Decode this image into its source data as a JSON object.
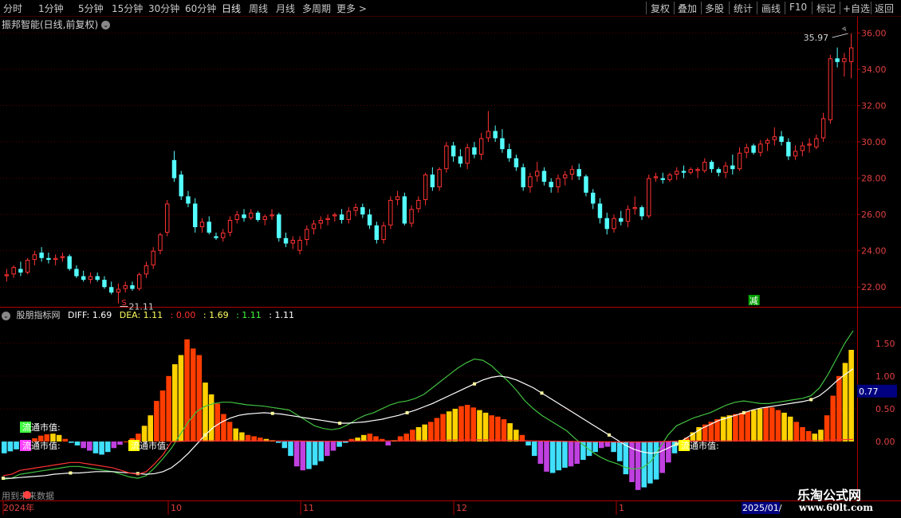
{
  "toolbar": {
    "periods": [
      "分时",
      "1分钟",
      "5分钟",
      "15分钟",
      "30分钟",
      "60分钟",
      "日线",
      "周线",
      "月线",
      "多周期",
      "更多 >"
    ],
    "active_period": "日线",
    "right_buttons": [
      "复权",
      "叠加",
      "多股",
      "统计",
      "画线",
      "F10",
      "标记",
      "+自选",
      "返回"
    ]
  },
  "main_chart": {
    "title": "振邦智能(日线,前复权)",
    "high_label": "35.97",
    "low_label": "21.11",
    "marker_s": "S",
    "marker_jian": "减",
    "y_ticks": [
      "36.00",
      "34.00",
      "32.00",
      "30.00",
      "28.00",
      "26.00",
      "24.00",
      "22.00"
    ]
  },
  "indicator": {
    "name": "股朋指标网",
    "diff_label": "DIFF: 1.69",
    "dea_label": "DEA: 1.11",
    "v1": ": 0.00",
    "v2": ": 1.69",
    "v3": ": 1.11",
    "v4": ": 1.11",
    "y_ticks": [
      "1.50",
      "1.00",
      "0.50",
      "0.00"
    ],
    "current_value": "0.77",
    "labels": [
      "流通市值:",
      "流通市值:",
      "流通市值:",
      "流通市值:"
    ],
    "bottom_text": "用到未来数据"
  },
  "x_axis": {
    "labels": [
      "2024年",
      "10",
      "11",
      "12",
      "1",
      "2025/01/"
    ]
  },
  "watermark": {
    "line1": "乐淘公式网",
    "line2": "www.60lt.com"
  },
  "colors": {
    "up": "#ff3232",
    "down": "#54ffff",
    "macd_pos_a": "#ff3d00",
    "macd_pos_b": "#ffd200",
    "macd_neg_a": "#40e0ff",
    "macd_neg_b": "#c040e0",
    "diff_line": "#ffffff",
    "dea_line": "#ffff60"
  },
  "chart_data": {
    "type": "candlestick",
    "ylim": [
      21.0,
      36.5
    ],
    "candles": [
      [
        22.6,
        23.0,
        22.3,
        22.7
      ],
      [
        22.7,
        23.2,
        22.5,
        23.1
      ],
      [
        23.0,
        23.4,
        22.6,
        22.8
      ],
      [
        22.8,
        23.6,
        22.7,
        23.5
      ],
      [
        23.5,
        24.0,
        23.2,
        23.8
      ],
      [
        23.9,
        24.2,
        23.4,
        23.6
      ],
      [
        23.6,
        23.9,
        23.3,
        23.5
      ],
      [
        23.5,
        23.8,
        23.2,
        23.6
      ],
      [
        23.6,
        23.9,
        23.4,
        23.7
      ],
      [
        23.7,
        23.8,
        22.9,
        23.0
      ],
      [
        23.0,
        23.2,
        22.5,
        22.6
      ],
      [
        22.6,
        22.9,
        22.3,
        22.4
      ],
      [
        22.4,
        22.8,
        22.2,
        22.6
      ],
      [
        22.6,
        22.8,
        22.3,
        22.4
      ],
      [
        22.4,
        22.6,
        21.9,
        22.0
      ],
      [
        22.0,
        22.3,
        21.6,
        21.7
      ],
      [
        21.7,
        22.2,
        21.1,
        21.9
      ],
      [
        21.9,
        22.3,
        21.7,
        22.1
      ],
      [
        22.1,
        22.3,
        21.8,
        21.9
      ],
      [
        21.9,
        22.8,
        21.8,
        22.7
      ],
      [
        22.7,
        23.4,
        22.5,
        23.2
      ],
      [
        23.2,
        24.2,
        23.0,
        24.0
      ],
      [
        24.0,
        25.0,
        23.8,
        24.9
      ],
      [
        25.0,
        26.8,
        24.8,
        26.6
      ],
      [
        29.0,
        29.5,
        27.8,
        28.0
      ],
      [
        28.2,
        28.4,
        26.8,
        27.0
      ],
      [
        27.0,
        27.3,
        26.4,
        26.6
      ],
      [
        26.6,
        26.9,
        25.0,
        25.3
      ],
      [
        25.3,
        25.8,
        25.0,
        25.6
      ],
      [
        25.6,
        25.9,
        24.9,
        25.0
      ],
      [
        24.8,
        25.0,
        24.6,
        24.7
      ],
      [
        24.7,
        25.2,
        24.5,
        25.0
      ],
      [
        25.0,
        25.9,
        24.8,
        25.7
      ],
      [
        25.7,
        26.2,
        25.5,
        26.0
      ],
      [
        26.0,
        26.3,
        25.6,
        25.8
      ],
      [
        25.8,
        26.3,
        25.7,
        26.1
      ],
      [
        26.1,
        26.2,
        25.6,
        25.7
      ],
      [
        25.7,
        26.0,
        25.4,
        25.9
      ],
      [
        25.9,
        26.3,
        25.7,
        26.0
      ],
      [
        26.0,
        26.1,
        24.5,
        24.7
      ],
      [
        24.7,
        25.0,
        24.2,
        24.4
      ],
      [
        24.4,
        24.8,
        24.1,
        24.6
      ],
      [
        24.0,
        24.8,
        23.8,
        24.6
      ],
      [
        24.6,
        25.4,
        24.3,
        25.2
      ],
      [
        25.2,
        25.7,
        24.9,
        25.5
      ],
      [
        25.5,
        25.9,
        25.2,
        25.7
      ],
      [
        25.7,
        26.0,
        25.4,
        25.8
      ],
      [
        25.9,
        26.1,
        25.6,
        26.0
      ],
      [
        26.0,
        26.3,
        25.5,
        25.7
      ],
      [
        25.7,
        26.4,
        25.5,
        26.2
      ],
      [
        26.2,
        26.6,
        25.9,
        26.4
      ],
      [
        26.4,
        26.6,
        25.8,
        26.0
      ],
      [
        26.0,
        26.3,
        25.2,
        25.4
      ],
      [
        25.4,
        25.6,
        24.4,
        24.6
      ],
      [
        24.6,
        25.6,
        24.4,
        25.4
      ],
      [
        25.4,
        27.0,
        25.2,
        26.8
      ],
      [
        26.8,
        27.3,
        26.5,
        27.0
      ],
      [
        27.0,
        27.2,
        25.4,
        25.5
      ],
      [
        25.5,
        26.5,
        25.3,
        26.3
      ],
      [
        26.3,
        27.0,
        26.1,
        26.8
      ],
      [
        26.8,
        28.3,
        26.5,
        28.2
      ],
      [
        28.2,
        28.6,
        27.3,
        27.5
      ],
      [
        27.5,
        28.6,
        27.3,
        28.5
      ],
      [
        28.5,
        30.0,
        28.3,
        29.8
      ],
      [
        29.8,
        30.0,
        28.9,
        29.2
      ],
      [
        29.2,
        29.6,
        28.6,
        28.8
      ],
      [
        28.8,
        29.9,
        28.5,
        29.7
      ],
      [
        29.7,
        30.0,
        29.1,
        29.3
      ],
      [
        29.3,
        30.5,
        29.0,
        30.2
      ],
      [
        30.2,
        31.7,
        30.0,
        30.6
      ],
      [
        30.6,
        30.9,
        30.0,
        30.2
      ],
      [
        30.2,
        30.7,
        29.4,
        29.6
      ],
      [
        29.6,
        29.9,
        28.9,
        29.1
      ],
      [
        29.1,
        29.3,
        28.4,
        28.6
      ],
      [
        28.6,
        28.8,
        27.3,
        27.5
      ],
      [
        27.5,
        28.3,
        27.2,
        28.1
      ],
      [
        28.1,
        28.9,
        27.8,
        28.4
      ],
      [
        28.4,
        28.6,
        27.6,
        27.8
      ],
      [
        27.8,
        28.0,
        27.2,
        27.5
      ],
      [
        27.5,
        28.2,
        27.2,
        28.0
      ],
      [
        28.0,
        28.4,
        27.6,
        28.2
      ],
      [
        28.2,
        28.7,
        27.9,
        28.5
      ],
      [
        28.5,
        28.8,
        27.9,
        28.1
      ],
      [
        28.1,
        28.2,
        27.0,
        27.2
      ],
      [
        27.2,
        27.4,
        26.3,
        26.6
      ],
      [
        26.6,
        26.9,
        25.5,
        25.8
      ],
      [
        25.8,
        26.1,
        24.9,
        25.2
      ],
      [
        25.2,
        26.0,
        25.0,
        25.8
      ],
      [
        25.8,
        26.2,
        25.4,
        25.6
      ],
      [
        25.6,
        26.5,
        25.3,
        26.3
      ],
      [
        26.3,
        27.0,
        26.0,
        26.4
      ],
      [
        26.4,
        26.5,
        25.7,
        25.9
      ],
      [
        25.9,
        28.2,
        25.8,
        28.0
      ],
      [
        28.0,
        28.3,
        27.8,
        28.1
      ],
      [
        28.0,
        28.3,
        27.7,
        27.9
      ],
      [
        27.9,
        28.3,
        27.8,
        28.2
      ],
      [
        28.2,
        28.6,
        27.9,
        28.4
      ],
      [
        28.4,
        28.7,
        28.0,
        28.3
      ],
      [
        28.3,
        28.6,
        28.2,
        28.5
      ],
      [
        28.4,
        28.6,
        28.0,
        28.5
      ],
      [
        28.4,
        29.1,
        28.3,
        28.9
      ],
      [
        28.9,
        29.0,
        28.3,
        28.5
      ],
      [
        28.5,
        28.6,
        28.1,
        28.3
      ],
      [
        28.3,
        28.9,
        28.0,
        28.7
      ],
      [
        28.7,
        29.3,
        28.2,
        28.5
      ],
      [
        28.5,
        29.7,
        28.4,
        29.4
      ],
      [
        29.4,
        29.9,
        29.1,
        29.7
      ],
      [
        29.8,
        29.9,
        29.3,
        29.4
      ],
      [
        29.4,
        30.1,
        29.2,
        29.9
      ],
      [
        29.9,
        30.2,
        29.5,
        30.1
      ],
      [
        30.1,
        30.8,
        29.8,
        30.3
      ],
      [
        30.3,
        30.6,
        29.8,
        30.0
      ],
      [
        30.0,
        30.2,
        29.0,
        29.2
      ],
      [
        29.2,
        29.8,
        29.0,
        29.5
      ],
      [
        29.5,
        30.0,
        29.2,
        29.8
      ],
      [
        29.8,
        30.2,
        29.4,
        29.9
      ],
      [
        29.7,
        30.4,
        29.6,
        30.2
      ],
      [
        30.2,
        31.6,
        30.0,
        31.3
      ],
      [
        31.2,
        34.8,
        31.0,
        34.6
      ],
      [
        34.6,
        35.2,
        34.1,
        34.4
      ],
      [
        34.4,
        34.9,
        33.6,
        34.6
      ],
      [
        34.4,
        35.97,
        33.5,
        35.2
      ]
    ],
    "macd": [
      -0.18,
      -0.15,
      -0.12,
      -0.06,
      0.0,
      0.05,
      0.09,
      0.11,
      0.12,
      0.1,
      0.04,
      -0.02,
      -0.06,
      -0.1,
      -0.14,
      -0.18,
      -0.2,
      -0.16,
      -0.1,
      -0.05,
      0.0,
      0.05,
      0.12,
      0.24,
      0.4,
      0.62,
      0.78,
      1.0,
      1.18,
      1.32,
      1.56,
      1.42,
      1.32,
      0.9,
      0.72,
      0.58,
      0.42,
      0.3,
      0.2,
      0.14,
      0.1,
      0.08,
      0.06,
      0.04,
      0.02,
      -0.02,
      -0.1,
      -0.22,
      -0.38,
      -0.44,
      -0.42,
      -0.36,
      -0.3,
      -0.22,
      -0.14,
      -0.08,
      -0.02,
      0.04,
      0.06,
      0.1,
      0.12,
      0.08,
      0.04,
      -0.06,
      0.02,
      0.08,
      0.12,
      0.18,
      0.22,
      0.26,
      0.3,
      0.36,
      0.42,
      0.46,
      0.5,
      0.54,
      0.56,
      0.52,
      0.48,
      0.44,
      0.4,
      0.38,
      0.34,
      0.28,
      0.18,
      0.1,
      -0.06,
      -0.22,
      -0.34,
      -0.46,
      -0.48,
      -0.44,
      -0.4,
      -0.38,
      -0.34,
      -0.28,
      -0.22,
      -0.16,
      -0.1,
      -0.08,
      -0.16,
      -0.3,
      -0.5,
      -0.62,
      -0.74,
      -0.7,
      -0.64,
      -0.58,
      -0.48,
      -0.32,
      -0.18,
      -0.06,
      0.06,
      0.14,
      0.22,
      0.26,
      0.3,
      0.34,
      0.38,
      0.4,
      0.42,
      0.44,
      0.46,
      0.48,
      0.5,
      0.52,
      0.52,
      0.48,
      0.44,
      0.38,
      0.3,
      0.22,
      0.16,
      0.12,
      0.18,
      0.4,
      0.7,
      1.0,
      1.2,
      1.4
    ],
    "diff": [
      -0.58,
      -0.56,
      -0.5,
      -0.48,
      -0.46,
      -0.44,
      -0.42,
      -0.4,
      -0.38,
      -0.38,
      -0.4,
      -0.42,
      -0.44,
      -0.46,
      -0.5,
      -0.54,
      -0.56,
      -0.52,
      -0.4,
      -0.26,
      -0.1,
      0.1,
      0.3,
      0.46,
      0.54,
      0.58,
      0.6,
      0.6,
      0.58,
      0.56,
      0.55,
      0.54,
      0.52,
      0.5,
      0.48,
      0.4,
      0.32,
      0.24,
      0.2,
      0.18,
      0.2,
      0.26,
      0.34,
      0.4,
      0.44,
      0.5,
      0.56,
      0.6,
      0.62,
      0.66,
      0.72,
      0.82,
      0.92,
      1.02,
      1.12,
      1.2,
      1.26,
      1.24,
      1.16,
      1.04,
      0.92,
      0.78,
      0.62,
      0.5,
      0.4,
      0.32,
      0.24,
      0.16,
      0.04,
      -0.06,
      -0.16,
      -0.24,
      -0.3,
      -0.34,
      -0.4,
      -0.42,
      -0.4,
      -0.3,
      -0.1,
      0.1,
      0.24,
      0.3,
      0.36,
      0.4,
      0.44,
      0.5,
      0.56,
      0.6,
      0.62,
      0.6,
      0.58,
      0.58,
      0.6,
      0.62,
      0.64,
      0.66,
      0.7,
      0.82,
      1.02,
      1.26,
      1.5,
      1.69
    ],
    "dea": [
      -0.56,
      -0.56,
      -0.55,
      -0.54,
      -0.53,
      -0.52,
      -0.5,
      -0.49,
      -0.48,
      -0.48,
      -0.47,
      -0.46,
      -0.46,
      -0.46,
      -0.47,
      -0.48,
      -0.49,
      -0.5,
      -0.49,
      -0.46,
      -0.4,
      -0.3,
      -0.18,
      -0.04,
      0.1,
      0.22,
      0.3,
      0.36,
      0.4,
      0.42,
      0.43,
      0.44,
      0.43,
      0.42,
      0.4,
      0.38,
      0.36,
      0.34,
      0.32,
      0.3,
      0.28,
      0.28,
      0.29,
      0.3,
      0.32,
      0.34,
      0.37,
      0.4,
      0.44,
      0.48,
      0.53,
      0.58,
      0.64,
      0.7,
      0.76,
      0.82,
      0.88,
      0.94,
      0.98,
      1.0,
      0.98,
      0.94,
      0.88,
      0.82,
      0.74,
      0.66,
      0.58,
      0.5,
      0.42,
      0.34,
      0.26,
      0.18,
      0.1,
      0.02,
      -0.06,
      -0.12,
      -0.16,
      -0.18,
      -0.16,
      -0.1,
      -0.04,
      0.04,
      0.12,
      0.2,
      0.26,
      0.32,
      0.36,
      0.4,
      0.44,
      0.48,
      0.51,
      0.53,
      0.55,
      0.57,
      0.59,
      0.61,
      0.64,
      0.7,
      0.8,
      0.92,
      1.02,
      1.11
    ],
    "ind_ylim": [
      -0.9,
      1.85
    ]
  }
}
